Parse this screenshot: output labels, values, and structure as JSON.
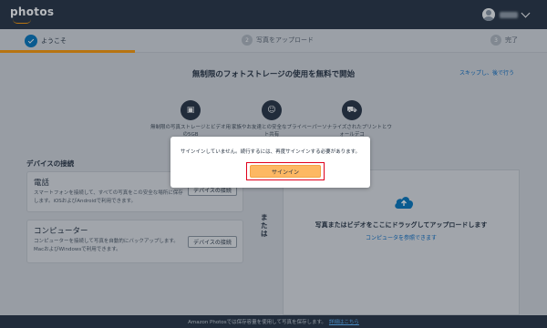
{
  "header": {
    "logo_text": "photos",
    "username": "",
    "colors": {
      "bar": "#232f3e",
      "smile": "#ff9900"
    }
  },
  "stepper": {
    "steps": [
      {
        "label": "ようこそ",
        "number": "",
        "state": "completed"
      },
      {
        "label": "写真をアップロード",
        "number": "2",
        "state": "pending"
      },
      {
        "label": "完了",
        "number": "3",
        "state": "pending"
      }
    ],
    "accent": "#ff9900"
  },
  "main": {
    "title": "無制限のフォトストレージの使用を無料で開始",
    "skip_link": "スキップし、後で行う",
    "features": [
      {
        "icon": "photo-storage-icon",
        "text": "無制限の写真ストレージとビデオ用の5GB"
      },
      {
        "icon": "family-icon",
        "text": "家族やお友達との安全なプライベート共有"
      },
      {
        "icon": "cart-icon",
        "text": "パーソナライズされたプリントとウォールデコ"
      }
    ],
    "devices_title": "デバイスの接続",
    "devices": [
      {
        "name": "電話",
        "desc": "スマートフォンを接続して、すべての写真をこの安全な場所に保存します。iOSおよびAndroidで利用できます。",
        "button": "デバイスの接続"
      },
      {
        "name": "コンピューター",
        "desc": "コンピューターを接続して写真を自動的にバックアップします。MacおよびWindowsで利用できます。",
        "button": "デバイスの接続"
      }
    ],
    "or_text": "または",
    "dropzone": {
      "title": "写真またはビデオをここにドラッグしてアップロードします",
      "link": "コンピュータを参照できます"
    }
  },
  "modal": {
    "message": "サインインしていません。続行するには、再度サインインする必要があります。",
    "signin_label": "サインイン",
    "colors": {
      "button": "#fdb863",
      "highlight": "#e0001b"
    }
  },
  "footer": {
    "text": "Amazon Photosでは保存容量を使用して写真を保存します。",
    "link": "詳細はこちら"
  }
}
